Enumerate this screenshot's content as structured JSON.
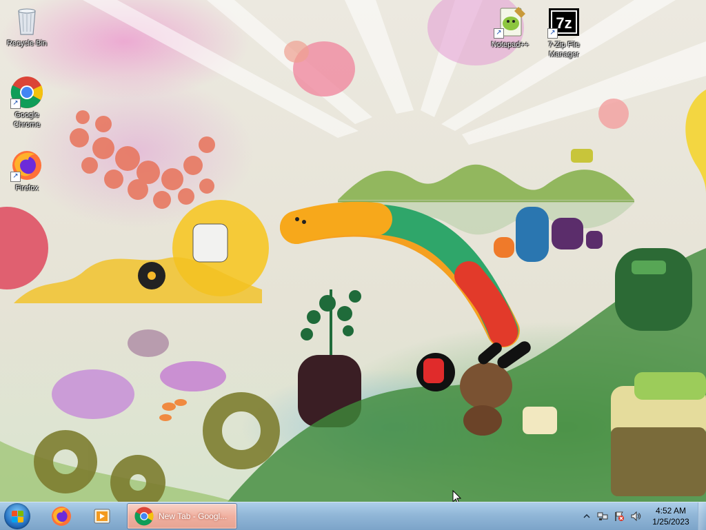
{
  "desktop": {
    "icons": [
      {
        "label": "Recycle Bin",
        "icon": "recycle-bin-icon"
      },
      {
        "label": "Google Chrome",
        "icon": "chrome-icon"
      },
      {
        "label": "Firefox",
        "icon": "firefox-icon"
      },
      {
        "label": "Notepad++",
        "icon": "notepad-plus-plus-icon"
      },
      {
        "label": "7-Zip File Manager",
        "icon": "seven-zip-icon"
      }
    ]
  },
  "taskbar": {
    "start_icon": "windows-start-icon",
    "pinned": [
      {
        "name": "Firefox",
        "icon": "firefox-icon"
      },
      {
        "name": "Windows Media Player",
        "icon": "media-player-icon"
      }
    ],
    "tasks": [
      {
        "title": "New Tab - Googl...",
        "icon": "chrome-icon"
      }
    ],
    "tray": {
      "icons": [
        "show-hidden-icons-chevron",
        "network-icon",
        "action-center-flag-icon",
        "volume-icon"
      ],
      "time": "4:52 AM",
      "date": "1/25/2023"
    }
  },
  "colors": {
    "taskbar": "#8cb4d7",
    "active_task": "#f0b0a0",
    "chrome_red": "#db4437",
    "chrome_yellow": "#f4c20d",
    "chrome_green": "#0f9d58",
    "chrome_blue": "#4285f4",
    "firefox_orange": "#ff7139"
  }
}
